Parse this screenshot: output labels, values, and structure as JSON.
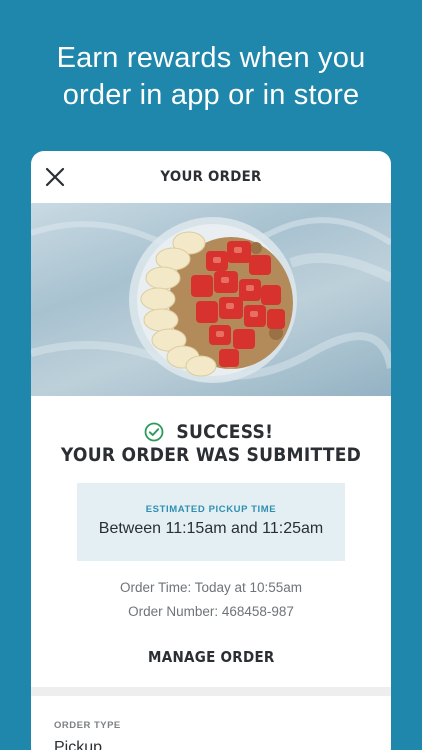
{
  "headline": {
    "line1": "Earn rewards when you",
    "line2": "order in app or in store"
  },
  "card": {
    "title": "YOUR ORDER",
    "close_icon": "close-icon",
    "success_title": "SUCCESS!",
    "submitted_text": "YOUR ORDER WAS SUBMITTED",
    "pickup_label": "ESTIMATED PICKUP TIME",
    "pickup_value": "Between 11:15am and 11:25am",
    "order_time": "Order Time: Today at 10:55am",
    "order_number": "Order Number: 468458-987",
    "manage_label": "MANAGE ORDER",
    "order_type_label": "ORDER TYPE",
    "order_type_value": "Pickup"
  },
  "colors": {
    "background": "#1e87ab",
    "accent": "#2f8fb0",
    "success": "#2e9a5a",
    "pickup_box": "#e4eff4"
  }
}
